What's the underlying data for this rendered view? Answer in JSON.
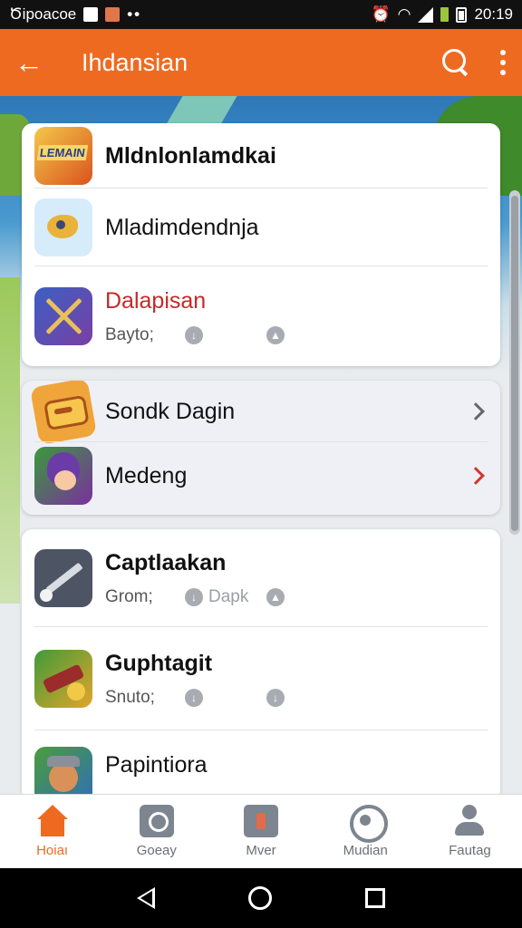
{
  "status_bar": {
    "left_text": "Ծipoacoe",
    "dots": "••",
    "time": "20:19"
  },
  "app_bar": {
    "back_glyph": "←",
    "title": "Ihdansian"
  },
  "card1": {
    "items": [
      {
        "name": "Mldnlonlamdkai",
        "icon": "lemain-game-icon",
        "icon_label": "LEMAIN"
      },
      {
        "name": "Mladimdendnja",
        "icon": "bird-game-icon"
      },
      {
        "name": "Dalapisan",
        "icon": "crossed-swords-game-icon",
        "meta_label": "Bayto;"
      }
    ]
  },
  "card2": {
    "items": [
      {
        "name": "Sondk Dagin",
        "icon": "treasure-chest-game-icon"
      },
      {
        "name": "Medeng",
        "icon": "hero-game-icon"
      }
    ]
  },
  "card3": {
    "items": [
      {
        "name": "Captlaakan",
        "icon": "knife-game-icon",
        "meta_label": "Grom;",
        "meta_extra": "Dapk"
      },
      {
        "name": "Guphtagit",
        "icon": "axe-game-icon",
        "meta_label": "Snuto;"
      },
      {
        "name": "Papintiora",
        "icon": "warrior-game-icon"
      }
    ]
  },
  "bottom_nav": {
    "tabs": [
      {
        "label": "Hoiaı",
        "icon": "home-icon",
        "active": true
      },
      {
        "label": "Goeay",
        "icon": "camera-icon"
      },
      {
        "label": "Mver",
        "icon": "shopping-bag-icon"
      },
      {
        "label": "Mudian",
        "icon": "chat-icon"
      },
      {
        "label": "Fautag",
        "icon": "user-icon"
      }
    ]
  },
  "colors": {
    "accent": "#ef6a21",
    "name_highlight": "#c62828",
    "status_bar": "#111111"
  }
}
